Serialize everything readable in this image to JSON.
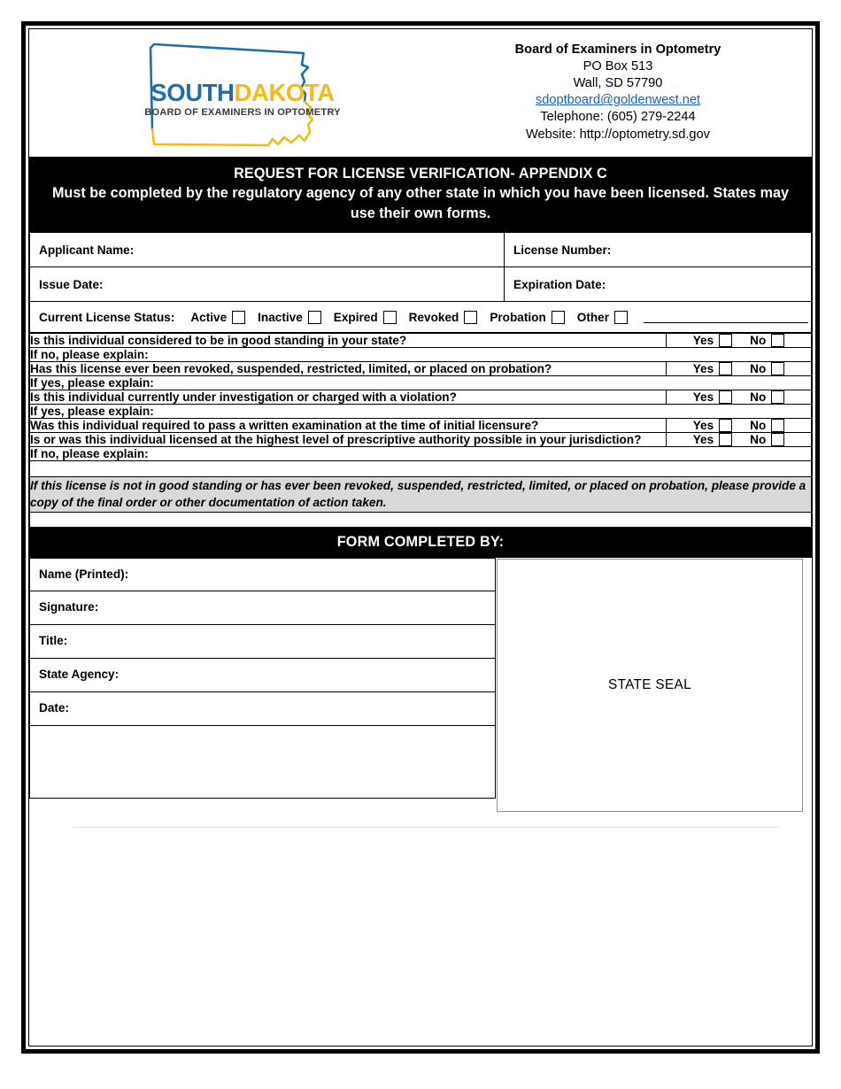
{
  "document": {
    "title": "REQUEST FOR LICENSE VERIFICATION- APPENDIX C",
    "subtitle": "Must be completed by the regulatory agency of any other state in which you have been licensed. States may use their own forms."
  },
  "logo": {
    "word_south": "SOUTH",
    "word_dakota": "DAKOTA",
    "tagline": "BOARD OF EXAMINERS IN OPTOMETRY",
    "color_blue": "#1f6eab",
    "color_yellow": "#f6b81a",
    "color_tagline": "#3b3b3b"
  },
  "header": {
    "org": "Board of Examiners in Optometry",
    "po_box": "PO Box 513",
    "city_state_zip": "Wall, SD  57790",
    "email": "sdoptboard@goldenwest.net",
    "telephone": "Telephone: (605) 279-2244",
    "website": "Website: http://optometry.sd.gov",
    "email_color": "#1a5fbe"
  },
  "fields": {
    "applicant_name": "Applicant Name:",
    "applicant_name_value": "",
    "license_number": "License Number:",
    "license_number_value": "",
    "issue_date": "Issue Date:",
    "issue_date_value": "",
    "expiration_date": "Expiration Date:",
    "expiration_date_value": ""
  },
  "status": {
    "label": "Current License Status:",
    "options": [
      {
        "label": "Active",
        "checked": false
      },
      {
        "label": "Inactive",
        "checked": false
      },
      {
        "label": "Expired",
        "checked": false
      },
      {
        "label": "Revoked",
        "checked": false
      },
      {
        "label": "Probation",
        "checked": false
      },
      {
        "label": "Other",
        "checked": false
      }
    ],
    "other_value": ""
  },
  "yes_label": "Yes",
  "no_label": "No",
  "questions": [
    {
      "text": "Is this individual considered to be in good standing in your state?",
      "yes_checked": false,
      "no_checked": false,
      "explain_label": "If no, please explain:",
      "explain_value": ""
    },
    {
      "text": "Has this license ever been revoked, suspended, restricted, limited, or placed on probation?",
      "yes_checked": false,
      "no_checked": false,
      "explain_label": "If yes, please explain:",
      "explain_value": ""
    },
    {
      "text": "Is this individual currently under investigation or charged with a violation?",
      "yes_checked": false,
      "no_checked": false,
      "explain_label": "If yes, please explain:",
      "explain_value": ""
    },
    {
      "text": "Was this individual required to pass a written examination at the time of initial licensure?",
      "yes_checked": false,
      "no_checked": false,
      "explain_label": null,
      "explain_value": ""
    },
    {
      "text": "Is or was this individual licensed at the highest level of prescriptive authority possible in your jurisdiction?",
      "yes_checked": false,
      "no_checked": false,
      "explain_label": "If no, please explain:",
      "explain_value": ""
    }
  ],
  "note": {
    "text": "If this license is not in good standing or has ever been revoked, suspended, restricted, limited, or placed on probation, please provide a copy of the final order or other documentation of action taken.",
    "background": "#d9d9d9"
  },
  "completed_by": {
    "banner": "FORM COMPLETED BY:",
    "rows": [
      {
        "label": "Name (Printed):",
        "value": ""
      },
      {
        "label": "Signature:",
        "value": ""
      },
      {
        "label": "Title:",
        "value": ""
      },
      {
        "label": "State Agency:",
        "value": ""
      },
      {
        "label": "Date:",
        "value": ""
      }
    ],
    "seal_label": "STATE SEAL"
  }
}
